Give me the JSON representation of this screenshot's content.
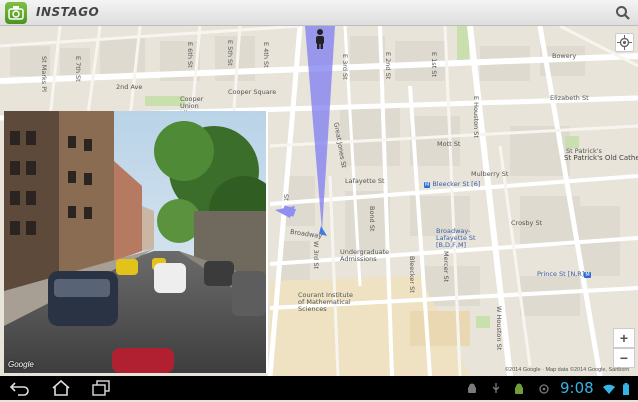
{
  "app": {
    "title": "INSTAGO"
  },
  "colors": {
    "accent": "#35b5e5",
    "road": "#ffffff",
    "park": "#c9dfae",
    "campus": "#efe2c3",
    "streetview_cone": "#7d7df2"
  },
  "icons": {
    "app": "app-logo-icon",
    "search": "search-icon",
    "locate": "my-location-icon",
    "pegman": "pegman-icon",
    "direction": "direction-arrow-icon",
    "back": "back-icon",
    "home": "home-icon",
    "recents": "recent-apps-icon",
    "android": "android-icon",
    "usb": "usb-icon",
    "wifi": "wifi-icon",
    "battery": "battery-icon"
  },
  "map": {
    "labels": {
      "st_marks": "St Marks Pl",
      "e7th": "E 7th St",
      "e6th": "E 6th St",
      "e5th": "E 5th St",
      "e4th": "E 4th St",
      "e3rd": "E 3rd St",
      "e2nd": "E 2nd St",
      "e1st": "E 1st St",
      "second_ave": "2nd Ave",
      "cooper_sq": "Cooper Square",
      "cooper_union": "Cooper Union Library",
      "great_jones": "Great Jones St",
      "bowery": "Bowery",
      "elizabeth": "Elizabeth St",
      "mott": "Mott St",
      "mulberry": "Mulberry St",
      "lafayette": "Lafayette St",
      "bleecker_station": "Bleecker St [6]",
      "st_patricks": "St Patrick's Old Cathedral",
      "st_patricks_short": "St Patrick's",
      "broadway_lafayette": "Broadway-Lafayette St [B,D,F,M]",
      "crosby": "Crosby St",
      "prince_station": "Prince St [N,R]",
      "broadway": "Broadway",
      "w3rd": "W 3rd St",
      "bond": "Bond St",
      "bleecker": "Bleecker St",
      "mercer": "Mercer St",
      "e_houston": "E Houston St",
      "w_houston": "W Houston St",
      "undergrad": "Undergraduate Admissions",
      "courant": "Courant Institute of Mathematical Sciences",
      "st_short": "St"
    },
    "controls": {
      "zoom_in": "+",
      "zoom_out": "−"
    },
    "attribution": "©2014 Google · Map data ©2014 Google, Sanborn"
  },
  "street_view": {
    "watermark": "Google"
  },
  "navbar": {
    "clock": "9:08"
  }
}
